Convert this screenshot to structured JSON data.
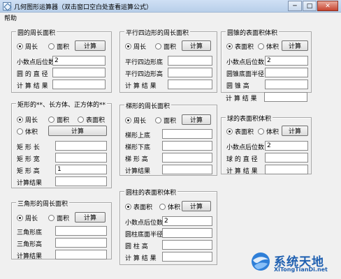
{
  "window": {
    "title": "几何图形运算器（双击窗口空白处查看运算公式）",
    "min": "─",
    "max": "□",
    "close": "✕"
  },
  "menu": {
    "help": "帮助"
  },
  "circle": {
    "title": "圆的周长面积",
    "opt1": "周长",
    "opt2": "面积",
    "calc": "计算",
    "decimals_label": "小数点后位数",
    "decimals": "2",
    "radius_label": "圆 的 直 径",
    "radius": "",
    "result_label": "计 算 结 果",
    "result": ""
  },
  "rect": {
    "title": "矩形的**、长方体、正方体的**",
    "opt1": "周长",
    "opt2": "面积",
    "opt3": "表面积",
    "opt4": "体积",
    "calc": "计算",
    "len_label": "矩 形 长",
    "len": "",
    "wid_label": "矩 形 宽",
    "wid": "",
    "hei_label": "矩 形 高",
    "hei": "1",
    "result_label": "计算结果",
    "result": ""
  },
  "tri": {
    "title": "三角形的周长面积",
    "opt1": "周长",
    "opt2": "面积",
    "calc": "计算",
    "base_label": "三角形底",
    "base": "",
    "hei_label": "三角形高",
    "hei": "",
    "result_label": "计算结果",
    "result": ""
  },
  "para": {
    "title": "平行四边形的周长面积",
    "opt1": "周长",
    "opt2": "面积",
    "calc": "计算",
    "base_label": "平行四边形底",
    "base": "",
    "hei_label": "平行四边形高",
    "hei": "",
    "result_label": "计 算 结 果",
    "result": ""
  },
  "trap": {
    "title": "梯形的周长面积",
    "opt1": "周长",
    "opt2": "面积",
    "calc": "计算",
    "top_label": "梯形上底",
    "top": "",
    "bottom_label": "梯形下底",
    "bottom": "",
    "hei_label": "梯 形 高",
    "hei": "",
    "result_label": "计算结果",
    "result": ""
  },
  "cyl": {
    "title": "圆柱的表面积体积",
    "opt1": "表面积",
    "opt2": "体积",
    "calc": "计算",
    "decimals_label": "小数点后位数",
    "decimals": "2",
    "radius_label": "圆柱底面半径",
    "radius": "",
    "hei_label": "圆 柱 高",
    "hei": "",
    "result_label": "计 算 结 果",
    "result": ""
  },
  "cone": {
    "title": "圆锥的表面积体积",
    "opt1": "表面积",
    "opt2": "体积",
    "calc": "计算",
    "decimals_label": "小数点后位数",
    "decimals": "2",
    "radius_label": "圆锥底面半径",
    "radius": "",
    "hei_label": "圆 锥 高",
    "hei": "",
    "result_label": "计 算 结 果",
    "result": ""
  },
  "sphere": {
    "title": "球的表面积体积",
    "opt1": "表面积",
    "opt2": "体积",
    "calc": "计算",
    "decimals_label": "小数点后位数",
    "decimals": "2",
    "dia_label": "球 的 直 径",
    "dia": "",
    "result_label": "计 算 结 果",
    "result": ""
  },
  "watermark": {
    "cn": "系统天地",
    "en": "XiTongTianDi.net"
  },
  "colors": {
    "accent": "#1e5fb0"
  }
}
